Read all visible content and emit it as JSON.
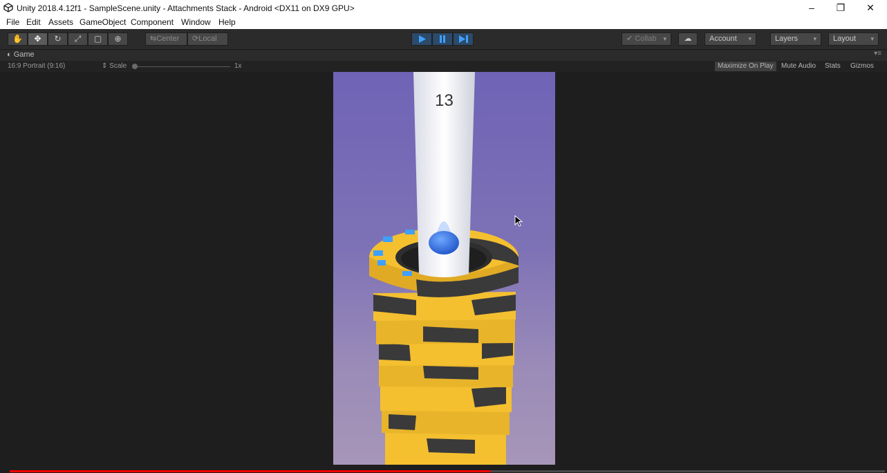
{
  "window": {
    "title": "Unity 2018.4.12f1 - SampleScene.unity - Attachments Stack - Android <DX11 on DX9 GPU>",
    "controls": {
      "minimize": "–",
      "restore": "❐",
      "close": "✕"
    }
  },
  "menu": [
    "File",
    "Edit",
    "Assets",
    "GameObject",
    "Component",
    "Window",
    "Help"
  ],
  "toolbar": {
    "transform_tools": [
      {
        "name": "hand-tool",
        "icon": "✋"
      },
      {
        "name": "move-tool",
        "icon": "✥"
      },
      {
        "name": "rotate-tool",
        "icon": "↻"
      },
      {
        "name": "scale-tool",
        "icon": "⤢"
      },
      {
        "name": "rect-tool",
        "icon": "▢"
      },
      {
        "name": "transform-tool",
        "icon": "⊕"
      }
    ],
    "pivot": "Center",
    "space": "Local",
    "collab": "Collab",
    "account": "Account",
    "layers": "Layers",
    "layout": "Layout"
  },
  "game_tab": {
    "label": "Game",
    "aspect": "16:9 Portrait (9:16)",
    "scale_label": "Scale",
    "scale_value": "1x",
    "maximize_on_play": "Maximize On Play",
    "mute_audio": "Mute Audio",
    "stats": "Stats",
    "gizmos": "Gizmos"
  },
  "game": {
    "score": "13",
    "colors": {
      "tower": "#f4c030",
      "dark": "#3a3a3a",
      "ball": "#2f6fe0",
      "pole": "#f2f2f2"
    }
  },
  "video_progress": 0.55
}
